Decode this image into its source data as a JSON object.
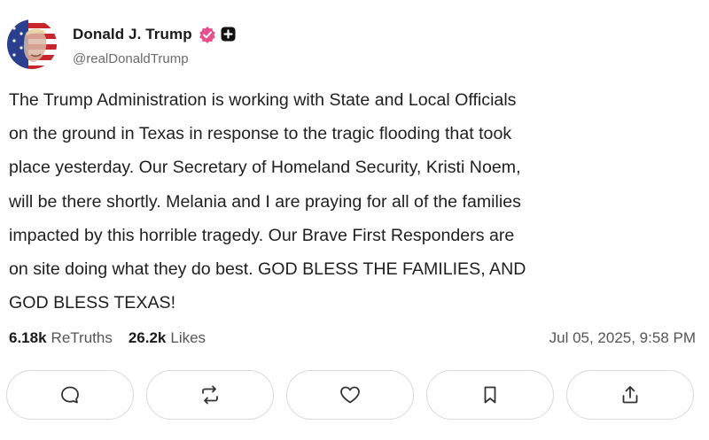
{
  "post": {
    "author": {
      "display_name": "Donald J. Trump",
      "handle": "@realDonaldTrump",
      "verified": true
    },
    "text": "The Trump Administration is working with State and Local Officials\non the ground in Texas in response to the tragic flooding that took\nplace yesterday. Our Secretary of Homeland Security, Kristi Noem,\nwill be there shortly. Melania and I are praying for all of the families\nimpacted by this horrible tragedy. Our Brave First Responders are\non site doing what they do best. GOD BLESS THE FAMILIES, AND\nGOD BLESS TEXAS!",
    "stats": {
      "retruths_count": "6.18k",
      "retruths_label": "ReTruths",
      "likes_count": "26.2k",
      "likes_label": "Likes"
    },
    "timestamp": "Jul 05, 2025, 9:58 PM"
  },
  "actions": [
    {
      "icon": "reply-icon"
    },
    {
      "icon": "retruth-icon"
    },
    {
      "icon": "like-heart-icon"
    },
    {
      "icon": "bookmark-icon"
    },
    {
      "icon": "share-icon"
    }
  ],
  "colors": {
    "verified_badge": "#e6508c",
    "text": "#1f1f1f",
    "muted": "#6b6b6b",
    "border": "#d9d9d9"
  }
}
